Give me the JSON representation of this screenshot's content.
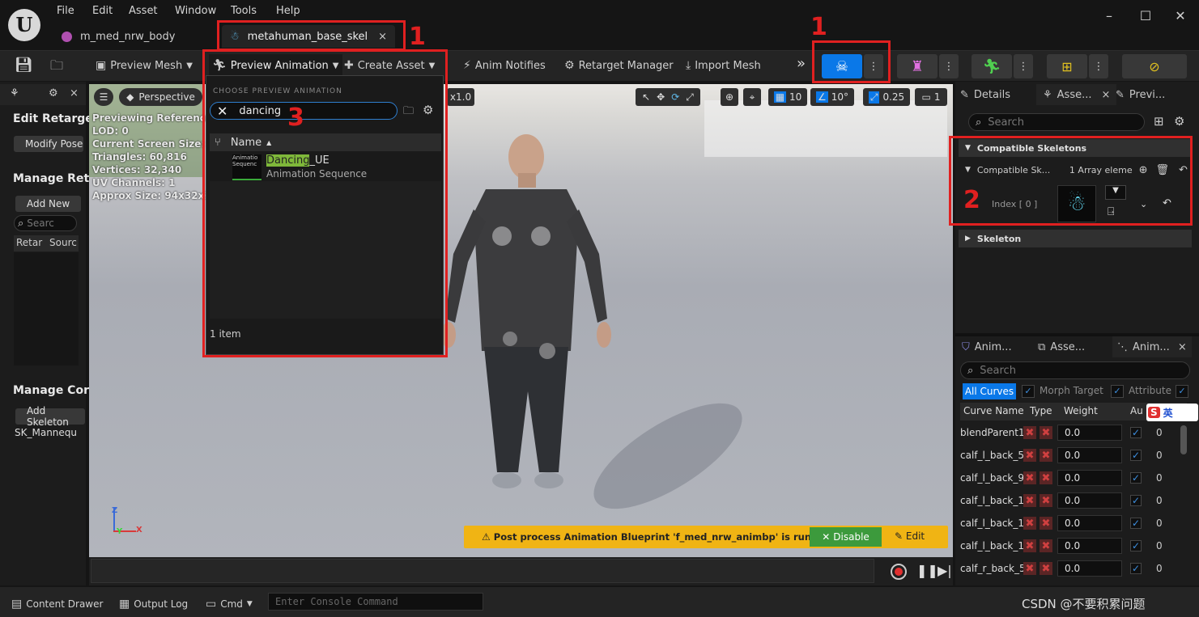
{
  "menu": [
    "File",
    "Edit",
    "Asset",
    "Window",
    "Tools",
    "Help"
  ],
  "tabs": [
    {
      "label": "m_med_nrw_body"
    },
    {
      "label": "metahuman_base_skel",
      "close": "×"
    }
  ],
  "toolbar": {
    "preview_mesh": "Preview Mesh",
    "preview_animation": "Preview Animation",
    "create_asset": "Create Asset",
    "anim_notifies": "Anim Notifies",
    "retarget_manager": "Retarget Manager",
    "import_mesh": "Import Mesh"
  },
  "left_panel": {
    "edit_retarget": "Edit Retarge",
    "modify_pose": "Modify Pose",
    "manage_ret": "Manage Ret",
    "add_new": "Add New",
    "search_placeholder": "Searc",
    "col_retarget": "Retar",
    "col_source": "Sourc",
    "manage_con": "Manage Cor",
    "add_skeleton": "Add Skeleton",
    "skeleton_item": "SK_Mannequ"
  },
  "viewport": {
    "perspective": "Perspective",
    "stats": [
      "Previewing Reference P",
      "LOD: 0",
      "Current Screen Size: 0.",
      "Triangles: 60,816",
      "Vertices: 32,340",
      "UV Channels: 1",
      "Approx Size: 94x32x162"
    ],
    "speed": "x1.0",
    "grid_snap": "10",
    "rot_snap": "10°",
    "scale_snap": "0.25",
    "camera_speed": "1",
    "warning": "Post process Animation Blueprint 'f_med_nrw_animbp' is running.",
    "disable": "Disable",
    "edit": "Edit",
    "axis_z": "Z",
    "axis_y": "Y",
    "axis_x": "X"
  },
  "dropdown": {
    "header": "CHOOSE PREVIEW ANIMATION",
    "search_value": "dancing",
    "col_name": "Name",
    "item_highlight": "Dancing",
    "item_rest": "_UE",
    "item_type": "Animation Sequence",
    "thumb_text": "Animatio Sequenc",
    "count": "1 item"
  },
  "annotations": [
    "1",
    "1",
    "2",
    "3"
  ],
  "details": {
    "tabs": [
      "Details",
      "Asse...",
      "Previ..."
    ],
    "search_placeholder": "Search",
    "section": "Compatible Skeletons",
    "prop": "Compatible Sk...",
    "array": "1 Array eleme",
    "index": "Index [ 0 ]",
    "skeleton_section": "Skeleton"
  },
  "curves": {
    "tabs": [
      "Anim...",
      "Asse...",
      "Anim..."
    ],
    "search_placeholder": "Search",
    "filters": [
      "All Curves",
      "Morph Target",
      "Attribute"
    ],
    "headers": [
      "Curve Name",
      "Type",
      "Weight",
      "Au"
    ],
    "rows": [
      {
        "name": "blendParent1",
        "weight": "0.0",
        "extra": "0"
      },
      {
        "name": "calf_l_back_5",
        "weight": "0.0",
        "extra": "0"
      },
      {
        "name": "calf_l_back_9",
        "weight": "0.0",
        "extra": "0"
      },
      {
        "name": "calf_l_back_1",
        "weight": "0.0",
        "extra": "0"
      },
      {
        "name": "calf_l_back_1",
        "weight": "0.0",
        "extra": "0"
      },
      {
        "name": "calf_l_back_1",
        "weight": "0.0",
        "extra": "0"
      },
      {
        "name": "calf_r_back_5",
        "weight": "0.0",
        "extra": "0"
      }
    ],
    "ime": "英"
  },
  "bottom": {
    "content_drawer": "Content Drawer",
    "output_log": "Output Log",
    "cmd": "Cmd",
    "console_placeholder": "Enter Console Command",
    "watermark": "CSDN @不要积累问题"
  }
}
